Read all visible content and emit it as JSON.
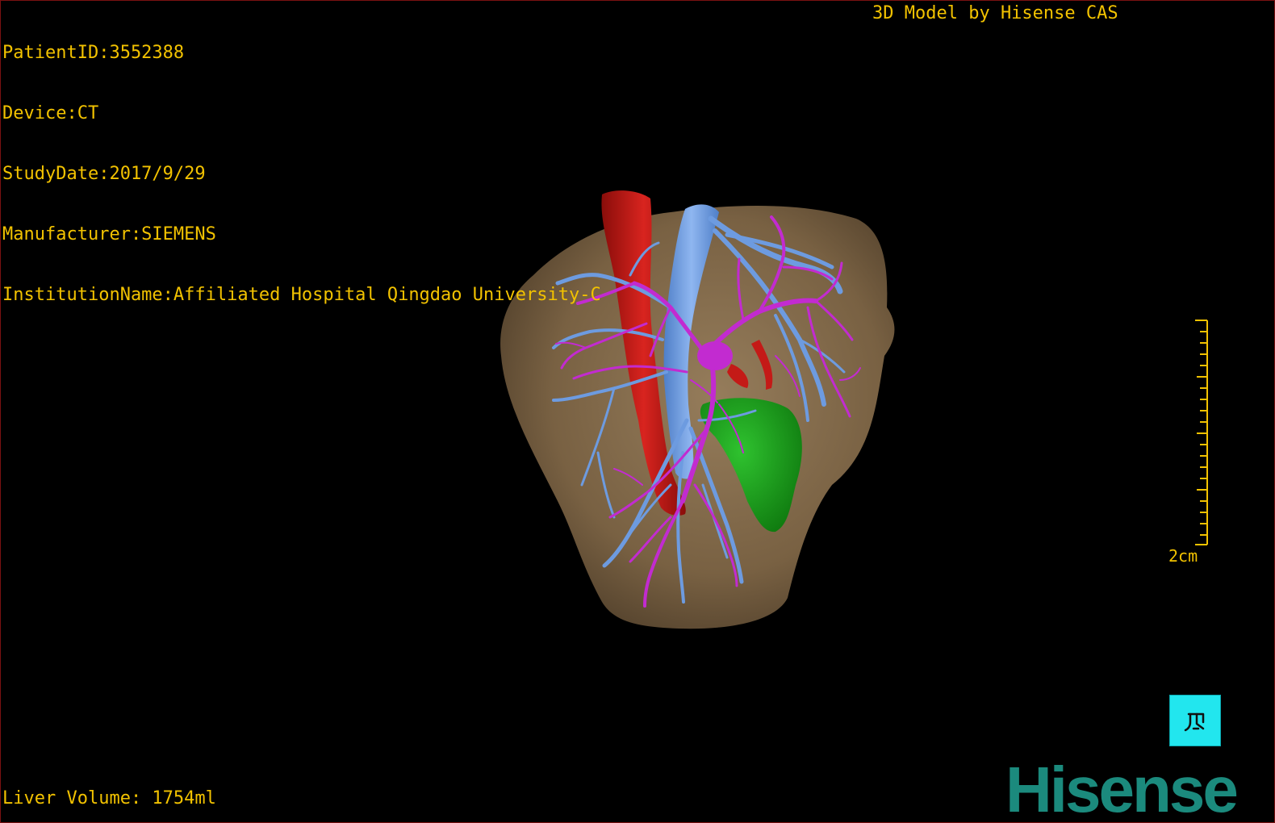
{
  "patient_info": {
    "patient_id": "PatientID:3552388",
    "device": "Device:CT",
    "study_date": "StudyDate:2017/9/29",
    "manufacturer": "Manufacturer:SIEMENS",
    "institution": "InstitutionName:Affiliated Hospital Qingdao University-C"
  },
  "model_credit": "3D Model by Hisense CAS",
  "liver_volume": "Liver Volume: 1754ml",
  "scale_bar": {
    "label": "2cm"
  },
  "orientation_button": {
    "icon": "orientation-icon"
  },
  "logo": {
    "text": "Hisense"
  },
  "colors": {
    "overlay_text": "#f2c200",
    "liver": "#8b7150",
    "artery": "#c41a17",
    "portal_vein": "#6d9be0",
    "hepatic_vessels": "#c22bd0",
    "gallbladder": "#19a019",
    "orientation_button": "#22e6ee",
    "logo": "#1b8a7d"
  }
}
